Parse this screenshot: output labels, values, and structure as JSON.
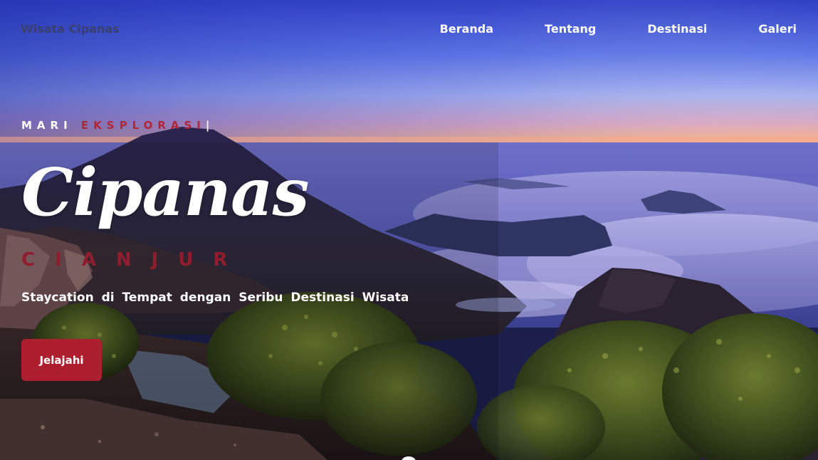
{
  "nav": {
    "brand": "Wisata Cipanas",
    "links": [
      "Beranda",
      "Tentang",
      "Destinasi",
      "Galeri"
    ]
  },
  "hero": {
    "kicker_lead": "MARI",
    "kicker_accent": "EKSPLORASI",
    "kicker_cursor": "|",
    "title": "Cipanas",
    "subtitle": "CIANJUR",
    "tagline": "Staycation di Tempat dengan Seribu Destinasi Wisata",
    "cta_label": "Jelajahi"
  },
  "colors": {
    "accent": "#ad1f2e",
    "subtitle": "#8f1d2e",
    "sky_top": "#3346c9",
    "horizon": "#ffb36b"
  },
  "icons": {
    "scroll_indicator": "scroll-down-indicator"
  }
}
